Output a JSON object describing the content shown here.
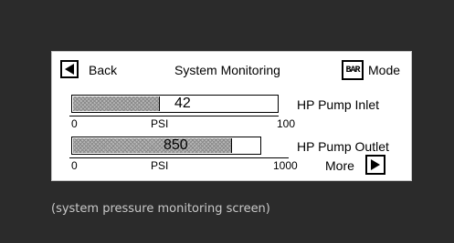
{
  "header": {
    "back_label": "Back",
    "title": "System Monitoring",
    "bar_icon_text": "BAR",
    "mode_label": "Mode"
  },
  "gauges": [
    {
      "name": "HP Pump Inlet",
      "value_text": "42",
      "value": 42,
      "min": "0",
      "max": "100",
      "unit": "PSI",
      "fill_fraction": 0.42
    },
    {
      "name": "HP Pump Outlet",
      "value_text": "850",
      "value": 850,
      "min": "0",
      "max": "1000",
      "unit": "PSI",
      "fill_fraction": 0.85
    }
  ],
  "footer": {
    "more_label": "More"
  },
  "caption": "(system pressure monitoring screen)",
  "colors": {
    "background": "#2b2b2b",
    "screen": "#ffffff",
    "caption": "#c9c9c9"
  },
  "icons": {
    "back": "left-triangle-icon",
    "more": "right-triangle-icon",
    "mode": "bar-icon"
  }
}
